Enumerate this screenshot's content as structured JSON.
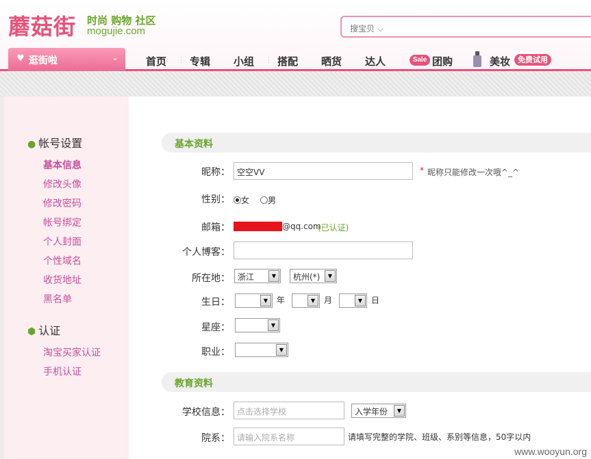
{
  "header": {
    "logo_cn": "蘑菇街",
    "slogan": "时尚 购物 社区",
    "logo_en": "mogujie.com",
    "search_scope": "搜宝贝",
    "search_chevron": "chevron-down-icon"
  },
  "nav": {
    "go_street": "逛街啦",
    "items": [
      "首页",
      "专辑",
      "小组",
      "搭配",
      "晒货",
      "达人",
      "团购",
      "美妆"
    ],
    "sale_badge": "Sale",
    "free_badge": "免费试用"
  },
  "sidebar": {
    "account_title": "帐号设置",
    "account_links": [
      "基本信息",
      "修改头像",
      "修改密码",
      "帐号绑定",
      "个人封面",
      "个性域名",
      "收货地址",
      "黑名单"
    ],
    "verify_title": "认证",
    "verify_links": [
      "淘宝买家认证",
      "手机认证"
    ]
  },
  "basic": {
    "section_title": "基本资料",
    "nickname_label": "昵称：",
    "nickname_value": "空空VV",
    "nickname_note_star": "*",
    "nickname_note": "昵称只能修改一次哦^_^",
    "gender_label": "性别：",
    "gender_female": "女",
    "gender_male": "男",
    "email_label": "邮箱：",
    "email_suffix": "@qq.com",
    "email_verified": "(已认证)",
    "blog_label": "个人博客：",
    "blog_value": "",
    "location_label": "所在地：",
    "province": "浙江",
    "city": "杭州(*)",
    "birthday_label": "生日：",
    "year_unit": "年",
    "month_unit": "月",
    "day_unit": "日",
    "star_label": "星座：",
    "job_label": "职业："
  },
  "education": {
    "section_title": "教育资料",
    "school_label": "学校信息：",
    "school_placeholder": "点击选择学校",
    "year_select": "入学年份",
    "dept_label": "院系：",
    "dept_placeholder": "请输入院系名称",
    "dept_hint": "请填写完整的学院、班级、系别等信息，50字以内"
  },
  "watermark": "www.wooyun.org",
  "colors": {
    "brand_pink": "#e8527a",
    "brand_green": "#6aa52a",
    "link_purple": "#c64f9a"
  }
}
